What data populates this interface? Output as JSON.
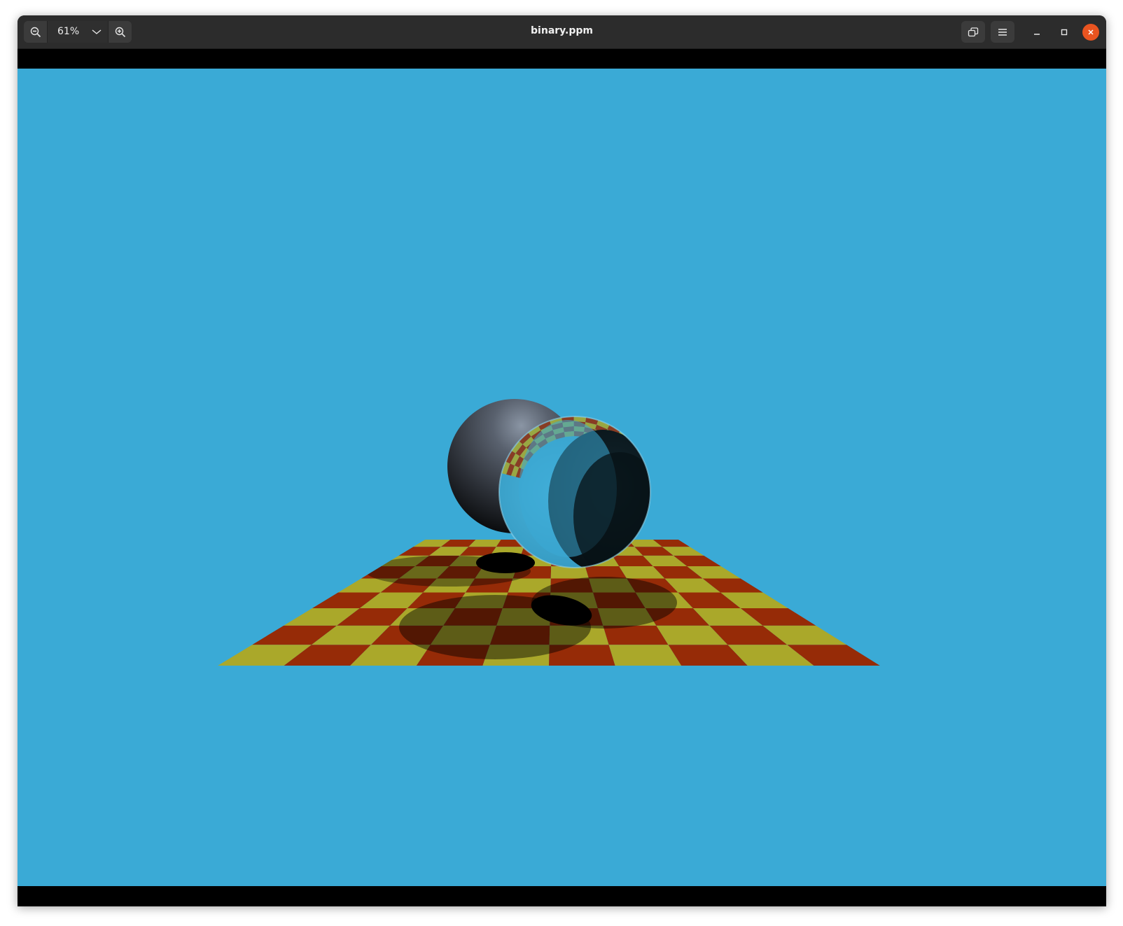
{
  "window": {
    "title": "binary.ppm"
  },
  "toolbar": {
    "zoom_out_icon": "zoom-out-icon",
    "zoom_level": "61%",
    "zoom_dropdown_icon": "chevron-down-icon",
    "zoom_in_icon": "zoom-in-icon",
    "view_toggle_icon": "window-restore-icon",
    "menu_icon": "hamburger-menu-icon"
  },
  "window_controls": {
    "minimize_icon": "minimize-icon",
    "maximize_icon": "maximize-icon",
    "close_icon": "close-icon"
  },
  "colors": {
    "titlebar": "#2c2c2c",
    "sky": "#3aaad6",
    "checker_red": "#962b07",
    "checker_yellow": "#aaa82a",
    "close_button": "#e95420"
  },
  "image": {
    "description_icon": "raytraced-render-image"
  }
}
